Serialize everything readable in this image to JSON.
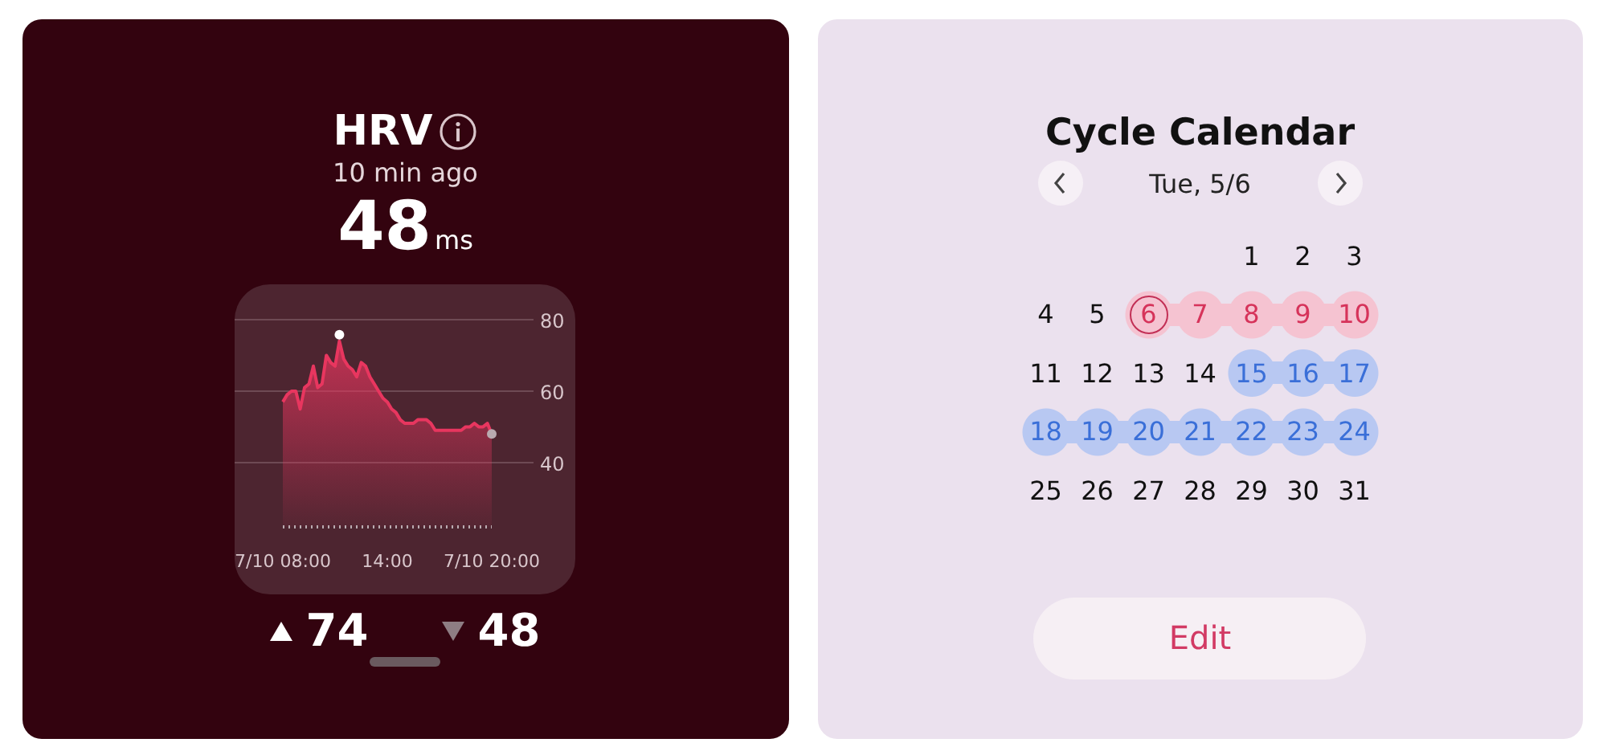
{
  "hrv_card": {
    "title": "HRV",
    "updated": "10 min ago",
    "value": "48",
    "unit": "ms",
    "chart_data": {
      "type": "area",
      "ylim": [
        22,
        80
      ],
      "yticks": [
        40,
        60,
        80
      ],
      "categories": [
        "7/10 08:00",
        null,
        null,
        null,
        null,
        null,
        null,
        null,
        null,
        null,
        null,
        null,
        null,
        null,
        null,
        null,
        null,
        null,
        null,
        null,
        null,
        null,
        null,
        null,
        "14:00",
        null,
        null,
        null,
        null,
        null,
        null,
        null,
        null,
        null,
        null,
        null,
        null,
        null,
        null,
        null,
        null,
        null,
        null,
        null,
        null,
        null,
        null,
        null,
        "7/10 20:00"
      ],
      "series": [
        {
          "color": "#e8365f",
          "values": [
            57,
            59,
            60,
            60,
            55,
            61,
            62,
            67,
            61,
            62,
            70,
            68,
            67,
            74,
            69,
            67,
            66,
            64,
            68,
            67,
            64,
            62,
            60,
            58,
            57,
            55,
            54,
            52,
            51,
            51,
            51,
            52,
            52,
            52,
            51,
            49,
            49,
            49,
            49,
            49,
            49,
            49,
            50,
            50,
            51,
            50,
            50,
            51,
            48
          ]
        }
      ]
    },
    "max": "74",
    "min": "48"
  },
  "cycle_calendar": {
    "title": "Cycle Calendar",
    "date": "Tue, 5/6",
    "weeks": [
      [
        {
          "day": "1",
          "kind": "plain",
          "selected": false
        },
        {
          "day": "2",
          "kind": "plain",
          "selected": false
        },
        {
          "day": "3",
          "kind": "plain",
          "selected": false
        }
      ],
      [
        {
          "day": "4",
          "kind": "plain",
          "selected": false
        },
        {
          "day": "5",
          "kind": "plain",
          "selected": false
        },
        {
          "day": "6",
          "kind": "period",
          "selected": true
        },
        {
          "day": "7",
          "kind": "period",
          "selected": false
        },
        {
          "day": "8",
          "kind": "period",
          "selected": false
        },
        {
          "day": "9",
          "kind": "period",
          "selected": false
        },
        {
          "day": "10",
          "kind": "period",
          "selected": false
        }
      ],
      [
        {
          "day": "11",
          "kind": "plain",
          "selected": false
        },
        {
          "day": "12",
          "kind": "plain",
          "selected": false
        },
        {
          "day": "13",
          "kind": "plain",
          "selected": false
        },
        {
          "day": "14",
          "kind": "plain",
          "selected": false
        },
        {
          "day": "15",
          "kind": "fertile",
          "selected": false
        },
        {
          "day": "16",
          "kind": "fertile",
          "selected": false
        },
        {
          "day": "17",
          "kind": "fertile",
          "selected": false
        }
      ],
      [
        {
          "day": "18",
          "kind": "fertile",
          "selected": false
        },
        {
          "day": "19",
          "kind": "fertile",
          "selected": false
        },
        {
          "day": "20",
          "kind": "fertile",
          "selected": false
        },
        {
          "day": "21",
          "kind": "fertile",
          "selected": false
        },
        {
          "day": "22",
          "kind": "fertile",
          "selected": false
        },
        {
          "day": "23",
          "kind": "fertile",
          "selected": false
        },
        {
          "day": "24",
          "kind": "fertile",
          "selected": false
        }
      ],
      [
        {
          "day": "25",
          "kind": "plain",
          "selected": false
        },
        {
          "day": "26",
          "kind": "plain",
          "selected": false
        },
        {
          "day": "27",
          "kind": "plain",
          "selected": false
        },
        {
          "day": "28",
          "kind": "plain",
          "selected": false
        },
        {
          "day": "29",
          "kind": "plain",
          "selected": false
        },
        {
          "day": "30",
          "kind": "plain",
          "selected": false
        },
        {
          "day": "31",
          "kind": "plain",
          "selected": false
        }
      ]
    ],
    "button": "Edit"
  }
}
